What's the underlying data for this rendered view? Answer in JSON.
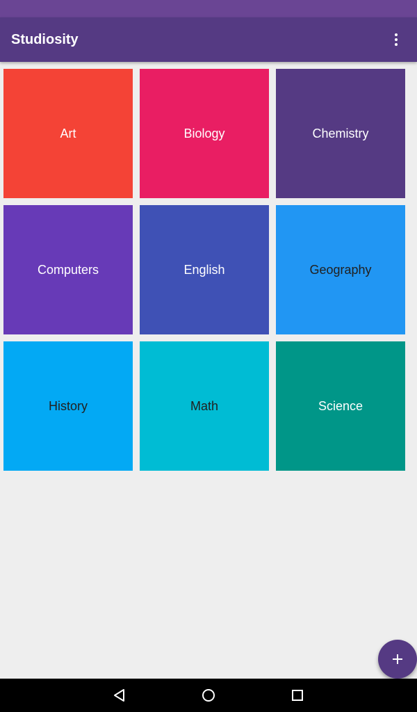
{
  "app_bar": {
    "title": "Studiosity",
    "overflow_icon": "more-vert-icon"
  },
  "colors": {
    "status_bar": "#6a4594",
    "app_bar": "#553a83",
    "background": "#eeeeee",
    "fab": "#553a83"
  },
  "subjects": [
    {
      "label": "Art",
      "color": "#f44336",
      "text_color": "#ffffff"
    },
    {
      "label": "Biology",
      "color": "#e91e63",
      "text_color": "#ffffff"
    },
    {
      "label": "Chemistry",
      "color": "#553a83",
      "text_color": "#ffffff"
    },
    {
      "label": "Computers",
      "color": "#673ab7",
      "text_color": "#ffffff"
    },
    {
      "label": "English",
      "color": "#3f51b5",
      "text_color": "#ffffff"
    },
    {
      "label": "Geography",
      "color": "#2196f3",
      "text_color": "#212121"
    },
    {
      "label": "History",
      "color": "#03a9f4",
      "text_color": "#212121"
    },
    {
      "label": "Math",
      "color": "#00bcd4",
      "text_color": "#212121"
    },
    {
      "label": "Science",
      "color": "#009688",
      "text_color": "#ffffff"
    }
  ],
  "fab": {
    "icon": "add-icon"
  },
  "nav_bar": {
    "back_icon": "back-triangle-icon",
    "home_icon": "home-circle-icon",
    "recents_icon": "recents-square-icon"
  }
}
